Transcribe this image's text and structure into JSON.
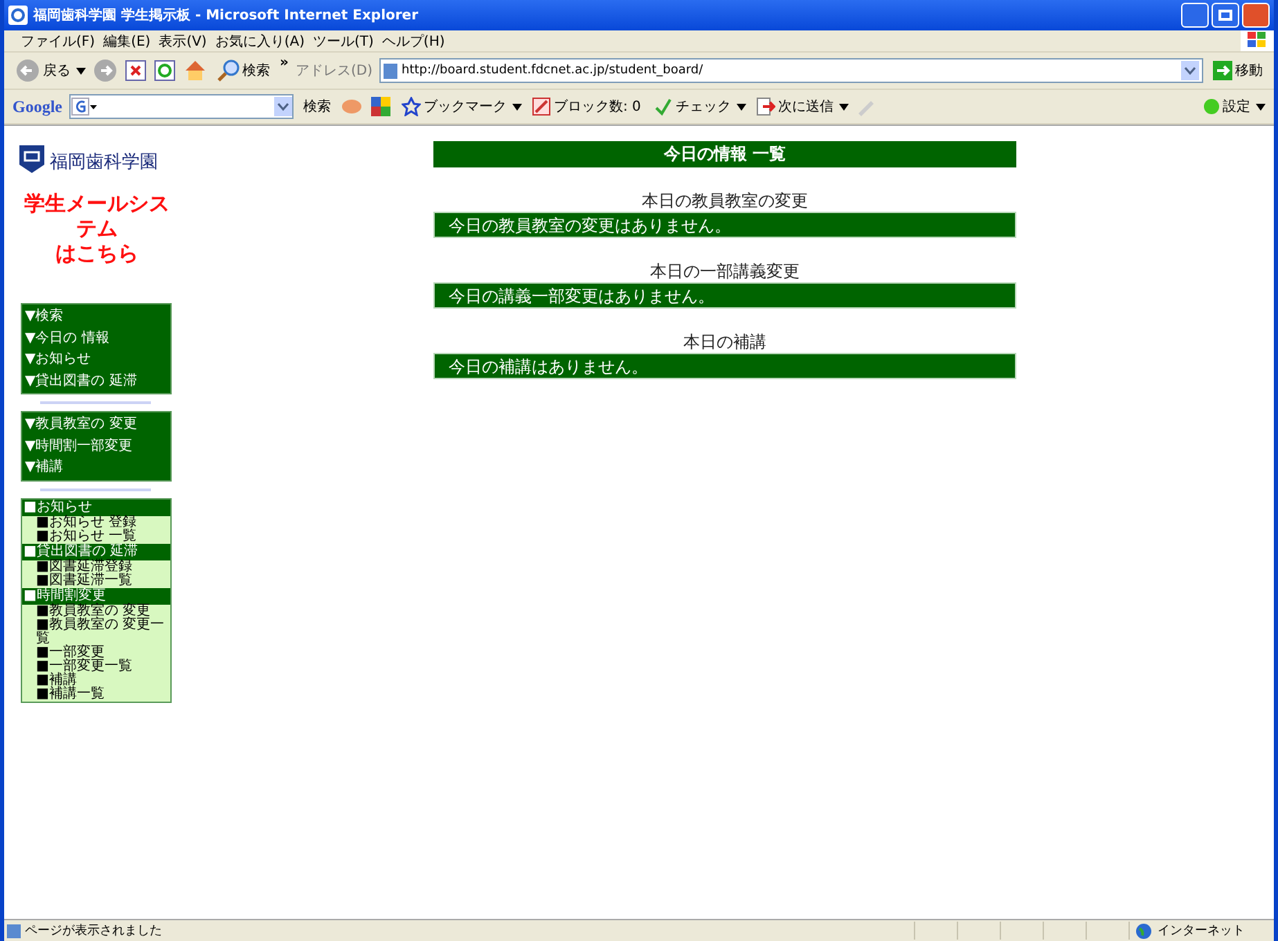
{
  "window": {
    "title": "福岡歯科学園  学生掲示板 - Microsoft Internet Explorer"
  },
  "menu_bar": [
    "ファイル(F)",
    "編集(E)",
    "表示(V)",
    "お気に入り(A)",
    "ツール(T)",
    "ヘルプ(H)"
  ],
  "toolbar": {
    "back": "戻る",
    "search": "検索",
    "more": "»",
    "address_label": "アドレス(D)",
    "url": "http://board.student.fdcnet.ac.jp/student_board/",
    "go": "移動"
  },
  "google_bar": {
    "logo": "Google",
    "search": "検索",
    "bookmarks": "ブックマーク",
    "blocked": "ブロック数: 0",
    "check": "チェック",
    "send": "次に送信",
    "settings": "設定"
  },
  "sidebar": {
    "logo_text": "福岡歯科学園",
    "mail_link": [
      "学生メールシステム",
      "はこちら"
    ],
    "menu_1": [
      "▼検索",
      "▼今日の 情報",
      "▼お知らせ",
      "▼貸出図書の 延滞"
    ],
    "menu_2": [
      "▼教員教室の 変更",
      "▼時間割一部変更",
      "▼補講"
    ],
    "menu_3": [
      {
        "kind": "header",
        "label": "■お知らせ"
      },
      {
        "kind": "item",
        "label": "■お知らせ 登録"
      },
      {
        "kind": "item",
        "label": "■お知らせ 一覧"
      },
      {
        "kind": "header",
        "label": "■貸出図書の 延滞"
      },
      {
        "kind": "item",
        "label": "■図書延滞登録"
      },
      {
        "kind": "item",
        "label": "■図書延滞一覧"
      },
      {
        "kind": "header",
        "label": "■時間割変更"
      },
      {
        "kind": "item",
        "label": "■教員教室の 変更"
      },
      {
        "kind": "item",
        "label": "■教員教室の 変更一覧"
      },
      {
        "kind": "item",
        "label": "■一部変更"
      },
      {
        "kind": "item",
        "label": "■一部変更一覧"
      },
      {
        "kind": "item",
        "label": "■補講"
      },
      {
        "kind": "item",
        "label": "■補講一覧"
      }
    ]
  },
  "main": {
    "heading": "今日の情報  一覧",
    "sections": [
      {
        "title": "本日の教員教室の変更",
        "message": "今日の教員教室の変更はありません。"
      },
      {
        "title": "本日の一部講義変更",
        "message": "今日の講義一部変更はありません。"
      },
      {
        "title": "本日の補講",
        "message": "今日の補講はありません。"
      }
    ]
  },
  "status_bar": {
    "text": "ページが表示されました",
    "zone": "インターネット"
  }
}
